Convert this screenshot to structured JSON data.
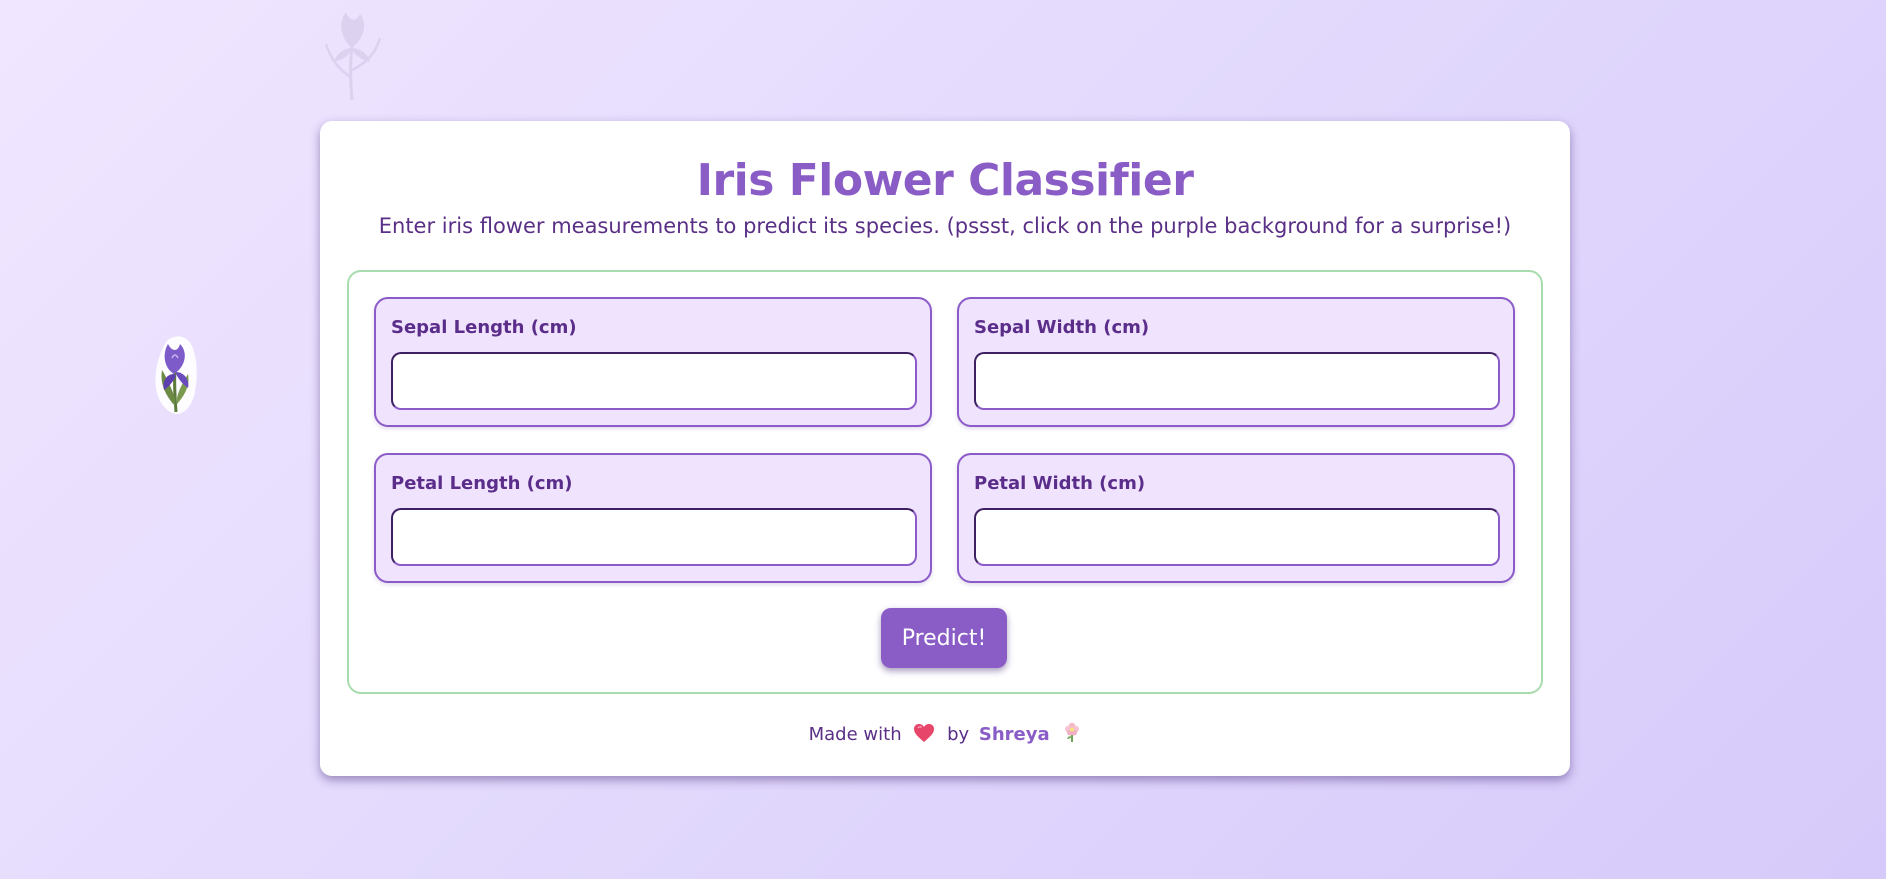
{
  "page": {
    "title": "Iris Flower Classifier",
    "subtitle": "Enter iris flower measurements to predict its species. (pssst, click on the purple background for a surprise!)"
  },
  "form": {
    "fields": [
      {
        "label": "Sepal Length (cm)",
        "value": "",
        "placeholder": ""
      },
      {
        "label": "Sepal Width (cm)",
        "value": "",
        "placeholder": ""
      },
      {
        "label": "Petal Length (cm)",
        "value": "",
        "placeholder": ""
      },
      {
        "label": "Petal Width (cm)",
        "value": "",
        "placeholder": ""
      }
    ],
    "submit_label": "Predict!"
  },
  "footer": {
    "made_with": "Made with",
    "by": "by",
    "author": "Shreya"
  },
  "icons": {
    "background_flowers": [
      "iris-flower-icon",
      "iris-flower-faded-icon"
    ],
    "footer": [
      "heart-icon",
      "blossom-icon"
    ]
  },
  "colors": {
    "accent": "#8a5cc6",
    "text": "#5a2f86",
    "field_bg": "#f0e3fd",
    "form_border": "#a8dcae",
    "heart": "#e8456b"
  }
}
